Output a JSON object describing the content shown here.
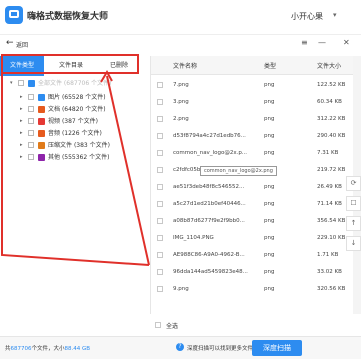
{
  "app": {
    "title": "嗨格式数据恢复大师",
    "user": "小开心果",
    "user_caret": "▾"
  },
  "window_controls": [
    "≡",
    "—",
    "✕"
  ],
  "back": {
    "arrow": "←",
    "label": "返回"
  },
  "tabs": [
    {
      "label": "文件类型",
      "active": true
    },
    {
      "label": "文件目录",
      "active": false
    },
    {
      "label": "已删除",
      "active": false
    }
  ],
  "tree": {
    "root_label": "全部文件 (687706 个文件)",
    "items": [
      {
        "label": "图片",
        "count": "(65528 个文件)",
        "icon_color": "#2d8cf0"
      },
      {
        "label": "文档",
        "count": "(64820 个文件)",
        "icon_color": "#e65a1e"
      },
      {
        "label": "视频",
        "count": "(387 个文件)",
        "icon_color": "#e53935"
      },
      {
        "label": "音频",
        "count": "(1226 个文件)",
        "icon_color": "#e65a1e"
      },
      {
        "label": "压缩文件",
        "count": "(383 个文件)",
        "icon_color": "#e07b1a"
      },
      {
        "label": "其他",
        "count": "(555362 个文件)",
        "icon_color": "#8e24aa"
      }
    ]
  },
  "list": {
    "headers": {
      "name": "文件名称",
      "type": "类型",
      "size": "文件大小"
    },
    "rows": [
      {
        "name": "7.png",
        "type": "png",
        "size": "122.52 KB"
      },
      {
        "name": "3.png",
        "type": "png",
        "size": "60.34 KB"
      },
      {
        "name": "2.png",
        "type": "png",
        "size": "312.22 KB"
      },
      {
        "name": "d53f8794a4c27d1edb76...",
        "type": "png",
        "size": "290.40 KB"
      },
      {
        "name": "common_nav_logo@2x.p...",
        "type": "png",
        "size": "7.31 KB"
      },
      {
        "name": "c2fdfc05b85e5c68d4669...",
        "type": "png",
        "size": "219.72 KB"
      },
      {
        "name": "ae51f3deb48f8c546552...",
        "type": "png",
        "size": "26.49 KB"
      },
      {
        "name": "a5c27d1ed21b0ef40446...",
        "type": "png",
        "size": "71.14 KB"
      },
      {
        "name": "a08b87d6277f9e2f9bb0...",
        "type": "png",
        "size": "356.54 KB"
      },
      {
        "name": "IMG_1104.PNG",
        "type": "png",
        "size": "229.10 KB"
      },
      {
        "name": "AE988C86-A9A0-4962-B...",
        "type": "png",
        "size": "1.71 KB"
      },
      {
        "name": "96dda144ad5459823e48...",
        "type": "png",
        "size": "33.02 KB"
      },
      {
        "name": "9.png",
        "type": "png",
        "size": "320.56 KB"
      }
    ],
    "tooltip": "common_nav_logo@2x.png",
    "select_all": "全选"
  },
  "side_tools": [
    "⟳",
    "☐",
    "↑",
    "↓"
  ],
  "bottom": {
    "summary_prefix": "共",
    "summary_count": "687706",
    "summary_mid": "个文件，大小",
    "summary_size": "88.44 GB",
    "hint_icon": "?",
    "hint": "深度扫描可以找到更多文件",
    "deep_scan_button": "深度扫描"
  },
  "colors": {
    "accent": "#2d8cf0",
    "annotation": "#e0302a"
  }
}
